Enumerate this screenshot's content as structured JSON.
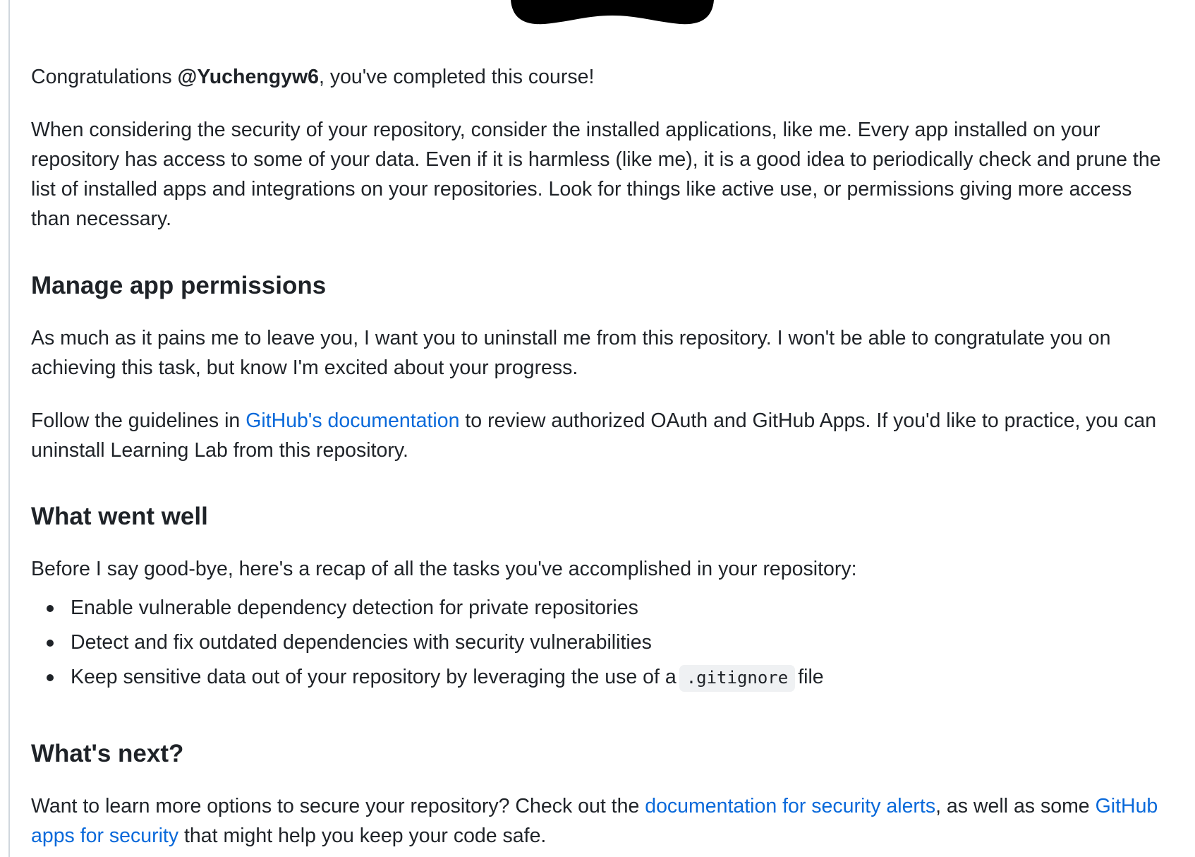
{
  "intro": {
    "prefix": "Congratulations ",
    "username": "@Yuchengyw6",
    "suffix": ", you've completed this course!"
  },
  "security_paragraph": "When considering the security of your repository, consider the installed applications, like me. Every app installed on your repository has access to some of your data. Even if it is harmless (like me), it is a good idea to periodically check and prune the list of installed apps and integrations on your repositories. Look for things like active use, or permissions giving more access than necessary.",
  "manage": {
    "heading": "Manage app permissions",
    "paragraph": "As much as it pains me to leave you, I want you to uninstall me from this repository. I won't be able to congratulate you on achieving this task, but know I'm excited about your progress.",
    "follow_prefix": "Follow the guidelines in ",
    "follow_link": "GitHub's documentation",
    "follow_suffix": " to review authorized OAuth and GitHub Apps. If you'd like to practice, you can uninstall Learning Lab from this repository."
  },
  "went_well": {
    "heading": "What went well",
    "intro": "Before I say good-bye, here's a recap of all the tasks you've accomplished in your repository:",
    "items": [
      "Enable vulnerable dependency detection for private repositories",
      "Detect and fix outdated dependencies with security vulnerabilities"
    ],
    "last_item_prefix": "Keep sensitive data out of your repository by leveraging the use of a",
    "last_item_code": ".gitignore",
    "last_item_suffix": "file"
  },
  "next": {
    "heading": "What's next?",
    "prefix": "Want to learn more options to secure your repository? Check out the ",
    "link1": "documentation for security alerts",
    "middle": ", as well as some ",
    "link2": "GitHub apps for security",
    "suffix": " that might help you keep your code safe."
  },
  "colors": {
    "text": "#1f2328",
    "link": "#0969da",
    "code_bg": "#eff1f3",
    "rule": "#d0d7de"
  },
  "icons": [
    "mascot-icon"
  ]
}
